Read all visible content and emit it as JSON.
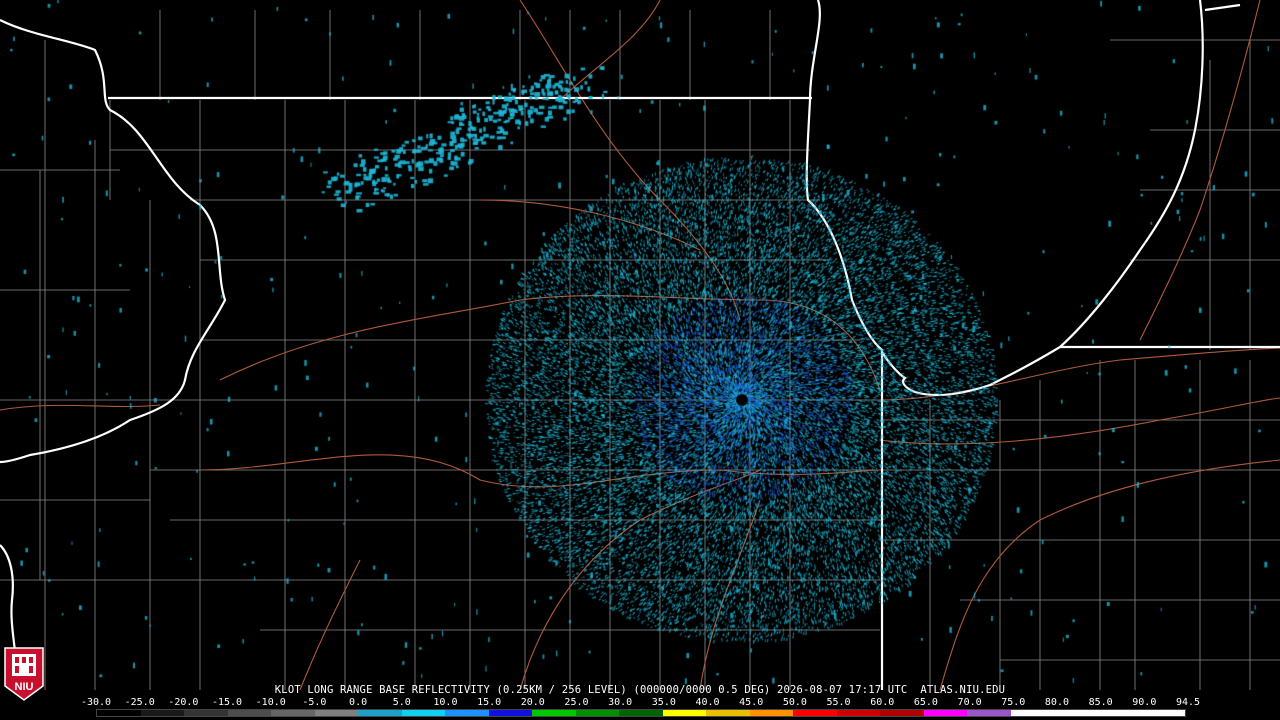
{
  "product": {
    "station": "KLOT",
    "title": "KLOT LONG RANGE BASE REFLECTIVITY (0.25KM / 256 LEVEL) (000000/0000 0.5 DEG) 2026-08-07 17:17 UTC  ATLAS.NIU.EDU"
  },
  "legend": {
    "labels": [
      "-30.0",
      "-25.0",
      "-20.0",
      "-15.0",
      "-10.0",
      "-5.0",
      "0.0",
      "5.0",
      "10.0",
      "15.0",
      "20.0",
      "25.0",
      "30.0",
      "35.0",
      "40.0",
      "45.0",
      "50.0",
      "55.0",
      "60.0",
      "65.0",
      "70.0",
      "75.0",
      "80.0",
      "85.0",
      "90.0",
      "94.5"
    ],
    "colors": [
      "#000000",
      "#1a1a1a",
      "#333333",
      "#4d4d4d",
      "#666666",
      "#808080",
      "#1fa0c8",
      "#12d0f0",
      "#1e90ff",
      "#1010e0",
      "#00c800",
      "#009000",
      "#006400",
      "#ffff00",
      "#e8c000",
      "#ff9000",
      "#ff0000",
      "#d00000",
      "#b00000",
      "#ff00ff",
      "#9955c9",
      "#ffffff",
      "#ffffff",
      "#ffffff",
      "#ffffff"
    ]
  },
  "logo": {
    "text": "NIU",
    "color": "#c8102e",
    "icon": "niu-seal-icon"
  },
  "colors": {
    "state_border": "#ffffff",
    "county_border": "#8a8a8a",
    "highway": "#b05a3a",
    "radar_light": "#1fb8d8",
    "radar_dark": "#1a5cd8",
    "background": "#000000"
  }
}
